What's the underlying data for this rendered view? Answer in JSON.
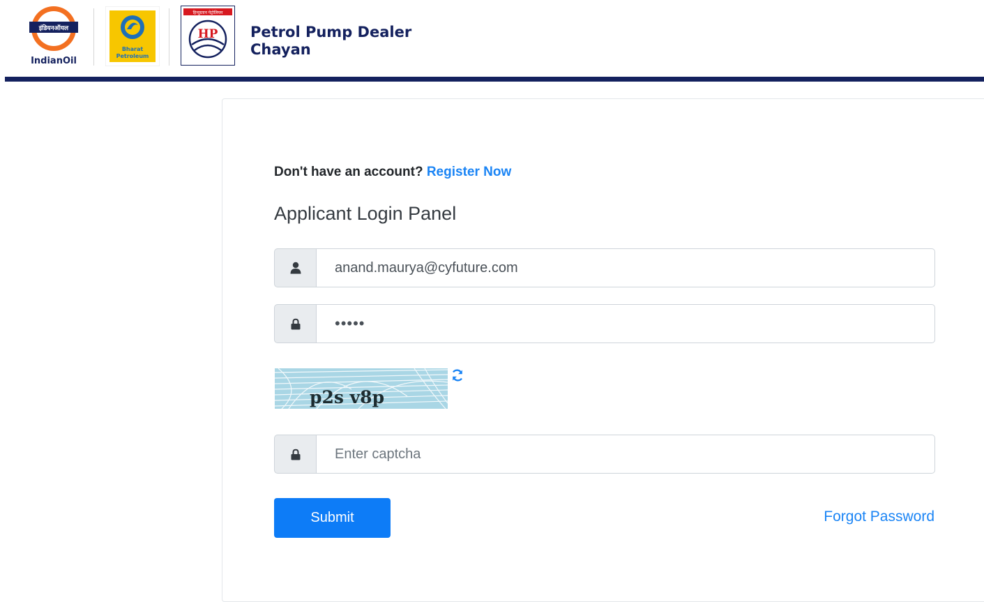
{
  "header": {
    "title_line1": "Petrol Pump Dealer",
    "title_line2": "Chayan",
    "logos": [
      {
        "name": "indianoil-logo",
        "text": "IndianOil",
        "mark_text": "इंडियनऑयल",
        "color": "#f37021"
      },
      {
        "name": "bharat-petroleum-logo",
        "line1": "Bharat",
        "line2": "Petroleum",
        "color": "#f7c600"
      },
      {
        "name": "hp-logo",
        "text": "HP",
        "banner_text": "हिन्दुस्तान पेट्रोलियम",
        "color": "#d71920"
      }
    ],
    "bar_color": "#14215e"
  },
  "login": {
    "register_prompt": "Don't have an account?",
    "register_link": "Register Now",
    "panel_title": "Applicant Login Panel",
    "email_value": "anand.maurya@cyfuture.com",
    "password_value": "•••••",
    "captcha_text": "p2s v8p",
    "captcha_placeholder": "Enter captcha",
    "submit_label": "Submit",
    "forgot_label": "Forgot Password",
    "icons": {
      "email": "user-icon",
      "password": "lock-icon",
      "captcha": "lock-icon",
      "refresh": "refresh-icon"
    }
  },
  "colors": {
    "accent": "#0d7cf7",
    "link": "#1a84f5",
    "header_bar": "#14215e"
  }
}
